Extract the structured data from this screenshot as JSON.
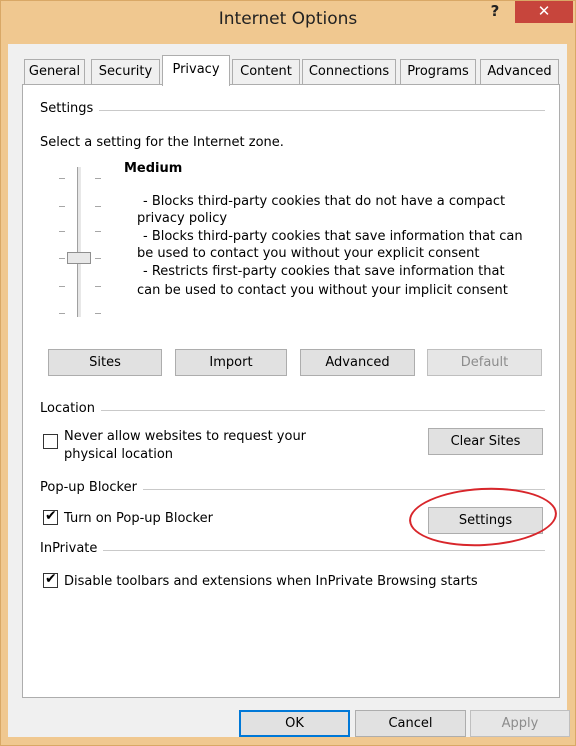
{
  "window": {
    "title": "Internet Options",
    "help_glyph": "?",
    "close_glyph": "✕"
  },
  "tabs": [
    {
      "label": "General"
    },
    {
      "label": "Security"
    },
    {
      "label": "Privacy",
      "active": true
    },
    {
      "label": "Content"
    },
    {
      "label": "Connections"
    },
    {
      "label": "Programs"
    },
    {
      "label": "Advanced"
    }
  ],
  "settings": {
    "group_label": "Settings",
    "zone_text": "Select a setting for the Internet zone.",
    "level": "Medium",
    "description_lines": [
      "- Blocks third-party cookies that do not have a compact",
      "privacy policy",
      "- Blocks third-party cookies that save information that can",
      "be used to contact you without your explicit consent",
      "- Restricts first-party cookies that save information that",
      "can be used to contact you without your implicit consent"
    ],
    "slider_level_fraction": 0.5,
    "buttons": {
      "sites": "Sites",
      "import": "Import",
      "advanced": "Advanced",
      "default": "Default"
    }
  },
  "location": {
    "group_label": "Location",
    "checkbox_label_line1": "Never allow websites to request your",
    "checkbox_label_line2": "physical location",
    "checked": false,
    "clear_sites": "Clear Sites"
  },
  "popup_blocker": {
    "group_label": "Pop-up Blocker",
    "checkbox_label": "Turn on Pop-up Blocker",
    "checked": true,
    "settings_button": "Settings"
  },
  "inprivate": {
    "group_label": "InPrivate",
    "checkbox_label": "Disable toolbars and extensions when InPrivate Browsing starts",
    "checked": true
  },
  "footer": {
    "ok": "OK",
    "cancel": "Cancel",
    "apply": "Apply"
  },
  "annotation_color": "#d8262b",
  "checkmark_glyph": "✔"
}
